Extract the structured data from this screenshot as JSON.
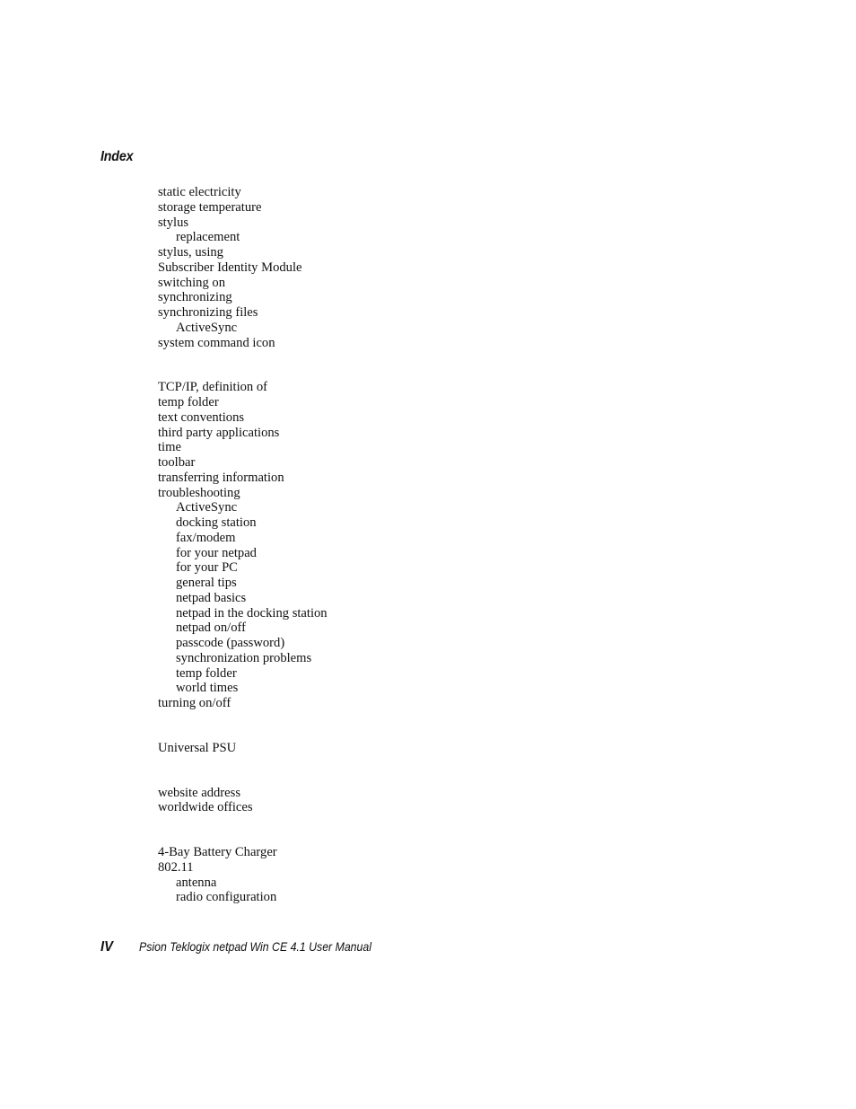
{
  "header": {
    "section_title": "Index"
  },
  "index_groups": [
    {
      "entries": [
        {
          "text": "static electricity",
          "level": 1
        },
        {
          "text": "storage temperature",
          "level": 1
        },
        {
          "text": "stylus",
          "level": 1
        },
        {
          "text": "replacement",
          "level": 2
        },
        {
          "text": "stylus, using",
          "level": 1
        },
        {
          "text": "Subscriber Identity Module",
          "level": 1
        },
        {
          "text": "switching on",
          "level": 1
        },
        {
          "text": "synchronizing",
          "level": 1
        },
        {
          "text": "synchronizing files",
          "level": 1
        },
        {
          "text": "ActiveSync",
          "level": 2
        },
        {
          "text": "system command icon",
          "level": 1
        }
      ]
    },
    {
      "entries": [
        {
          "text": "TCP/IP, definition of",
          "level": 1
        },
        {
          "text": "temp folder",
          "level": 1
        },
        {
          "text": "text conventions",
          "level": 1
        },
        {
          "text": "third party applications",
          "level": 1
        },
        {
          "text": "time",
          "level": 1
        },
        {
          "text": "toolbar",
          "level": 1
        },
        {
          "text": "transferring information",
          "level": 1
        },
        {
          "text": "troubleshooting",
          "level": 1
        },
        {
          "text": "ActiveSync",
          "level": 2
        },
        {
          "text": "docking station",
          "level": 2
        },
        {
          "text": "fax/modem",
          "level": 2
        },
        {
          "text": "for your netpad",
          "level": 2
        },
        {
          "text": "for your PC",
          "level": 2
        },
        {
          "text": "general tips",
          "level": 2
        },
        {
          "text": "netpad basics",
          "level": 2
        },
        {
          "text": "netpad in the docking station",
          "level": 2
        },
        {
          "text": "netpad on/off",
          "level": 2
        },
        {
          "text": "passcode (password)",
          "level": 2
        },
        {
          "text": "synchronization problems",
          "level": 2
        },
        {
          "text": "temp folder",
          "level": 2
        },
        {
          "text": "world times",
          "level": 2
        },
        {
          "text": "turning on/off",
          "level": 1
        }
      ]
    },
    {
      "entries": [
        {
          "text": "Universal PSU",
          "level": 1
        }
      ]
    },
    {
      "entries": [
        {
          "text": "website address",
          "level": 1
        },
        {
          "text": "worldwide offices",
          "level": 1
        }
      ]
    },
    {
      "entries": [
        {
          "text": "4-Bay Battery Charger",
          "level": 1
        },
        {
          "text": "802.11",
          "level": 1
        },
        {
          "text": "antenna",
          "level": 2
        },
        {
          "text": "radio configuration",
          "level": 2
        }
      ]
    }
  ],
  "footer": {
    "page_number": "IV",
    "manual_title": "Psion Teklogix netpad Win CE 4.1 User Manual"
  }
}
